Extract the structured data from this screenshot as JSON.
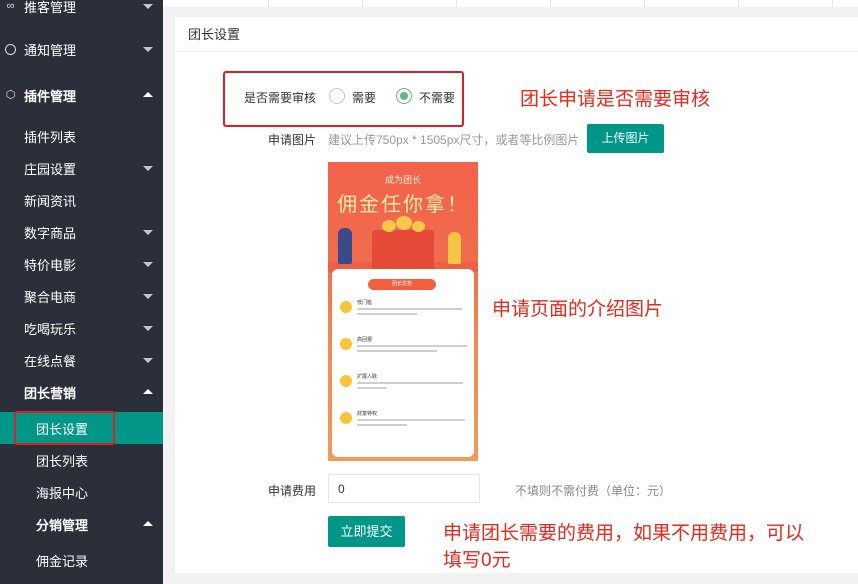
{
  "sidebar": {
    "items": [
      {
        "label": "推客管理",
        "icon": "infinity-icon"
      },
      {
        "label": "通知管理",
        "icon": "circle-icon"
      },
      {
        "label": "插件管理",
        "icon": "cube-icon"
      },
      {
        "label": "插件列表"
      },
      {
        "label": "庄园设置"
      },
      {
        "label": "新闻资讯"
      },
      {
        "label": "数字商品"
      },
      {
        "label": "特价电影"
      },
      {
        "label": "聚合电商"
      },
      {
        "label": "吃喝玩乐"
      },
      {
        "label": "在线点餐"
      },
      {
        "label": "团长营销"
      },
      {
        "label": "团长设置"
      },
      {
        "label": "团长列表"
      },
      {
        "label": "海报中心"
      },
      {
        "label": "分销管理"
      },
      {
        "label": "佣金记录"
      }
    ],
    "active_color": "#009688"
  },
  "panel": {
    "title": "团长设置",
    "review": {
      "label": "是否需要审核",
      "options": [
        "需要",
        "不需要"
      ],
      "selected": "不需要"
    },
    "image": {
      "label": "申请图片",
      "hint": "建议上传750px * 1505px尺寸，或者等比例图片",
      "button": "上传图片"
    },
    "poster": {
      "small": "成为团长",
      "big": "佣金任你拿！",
      "tag": "团长优势",
      "features": [
        "低门槛",
        "高回报",
        "扩展人脉",
        "财富特权"
      ]
    },
    "fee": {
      "label": "申请费用",
      "value": "0",
      "hint": "不填则不需付费（单位：元）"
    },
    "submit": "立即提交"
  },
  "annotations": {
    "review": "团长申请是否需要审核",
    "poster": "申请页面的介绍图片",
    "fee_line1": "申请团长需要的费用，如果不用费用，可以",
    "fee_line2": "填写0元"
  }
}
